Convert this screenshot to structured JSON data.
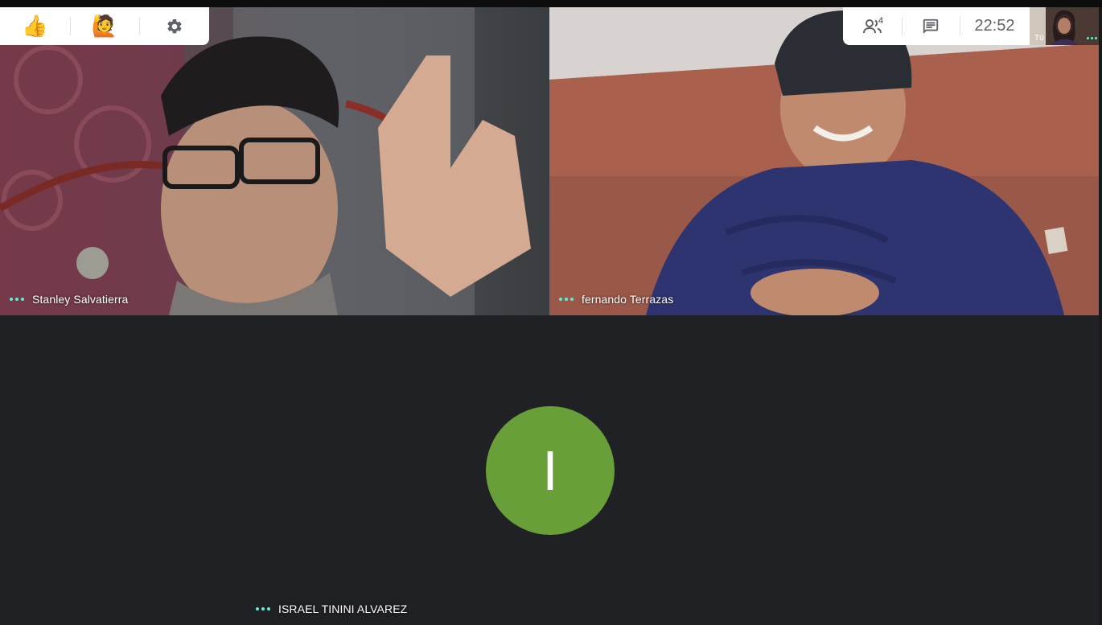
{
  "participants": [
    {
      "name": "Stanley Salvatierra"
    },
    {
      "name": "fernando Terrazas"
    },
    {
      "name": "ISRAEL TININI ALVAREZ",
      "avatar_letter": "I",
      "avatar_color": "#689f38"
    }
  ],
  "reactions": {
    "thumbs_up": "👍",
    "raise_hand": "🙋"
  },
  "toolbar": {
    "participant_count": "4",
    "clock": "22:52"
  },
  "self_view": {
    "label": "Tú"
  },
  "colors": {
    "background": "#202124",
    "indicator_dots": "#5ef0d6",
    "avatar": "#689f38"
  }
}
